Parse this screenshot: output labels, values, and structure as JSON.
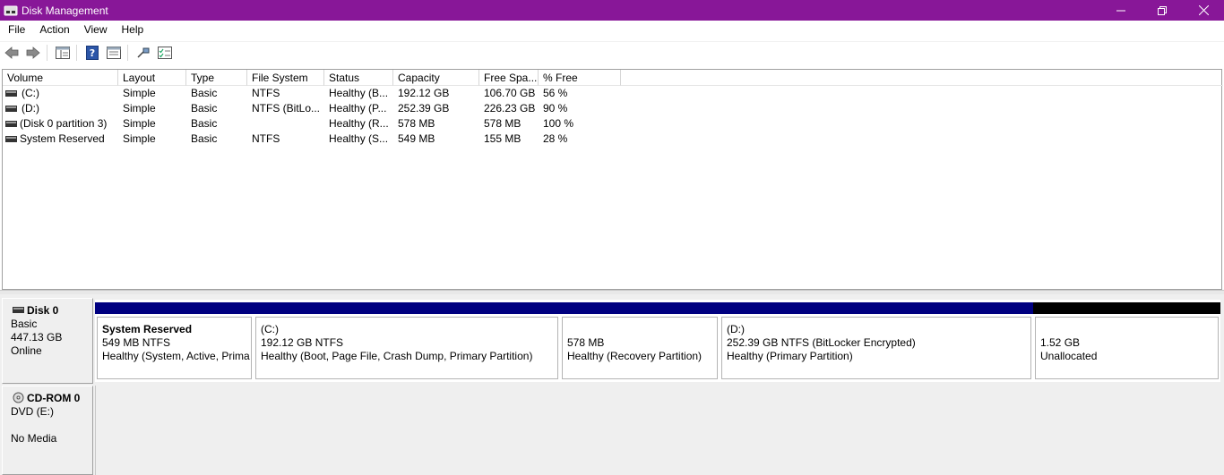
{
  "window": {
    "title": "Disk Management"
  },
  "menu": [
    "File",
    "Action",
    "View",
    "Help"
  ],
  "toolbar": {
    "icons": [
      "back-arrow-icon",
      "forward-arrow-icon",
      "console-tree-icon",
      "help-icon",
      "properties-icon",
      "connect-icon",
      "checklist-icon"
    ]
  },
  "columns": [
    "Volume",
    "Layout",
    "Type",
    "File System",
    "Status",
    "Capacity",
    "Free Spa...",
    "% Free"
  ],
  "volumes": [
    {
      "volume": "(C:)",
      "layout": "Simple",
      "type": "Basic",
      "fs": "NTFS",
      "status": "Healthy (B...",
      "capacity": "192.12 GB",
      "free": "106.70 GB",
      "pct": "56 %"
    },
    {
      "volume": "(D:)",
      "layout": "Simple",
      "type": "Basic",
      "fs": "NTFS (BitLo...",
      "status": "Healthy (P...",
      "capacity": "252.39 GB",
      "free": "226.23 GB",
      "pct": "90 %"
    },
    {
      "volume": "(Disk 0 partition 3)",
      "layout": "Simple",
      "type": "Basic",
      "fs": "",
      "status": "Healthy (R...",
      "capacity": "578 MB",
      "free": "578 MB",
      "pct": "100 %"
    },
    {
      "volume": "System Reserved",
      "layout": "Simple",
      "type": "Basic",
      "fs": "NTFS",
      "status": "Healthy (S...",
      "capacity": "549 MB",
      "free": "155 MB",
      "pct": "28 %"
    }
  ],
  "disk0": {
    "name": "Disk 0",
    "type": "Basic",
    "size": "447.13 GB",
    "state": "Online",
    "partitions": [
      {
        "title": "System Reserved",
        "line1": "549 MB NTFS",
        "line2": "Healthy (System, Active, Prima"
      },
      {
        "title": "(C:)",
        "line1": "192.12 GB NTFS",
        "line2": "Healthy (Boot, Page File, Crash Dump, Primary Partition)"
      },
      {
        "title": "",
        "line1": "578 MB",
        "line2": "Healthy (Recovery Partition)"
      },
      {
        "title": "(D:)",
        "line1": "252.39 GB NTFS (BitLocker Encrypted)",
        "line2": "Healthy (Primary Partition)"
      },
      {
        "title": "",
        "line1": "1.52 GB",
        "line2": "Unallocated"
      }
    ]
  },
  "cdrom0": {
    "name": "CD-ROM 0",
    "type": "DVD (E:)",
    "media": "No Media"
  },
  "colors": {
    "titlebar": "#881798",
    "primary_partition": "#000080",
    "unallocated": "#000000"
  }
}
